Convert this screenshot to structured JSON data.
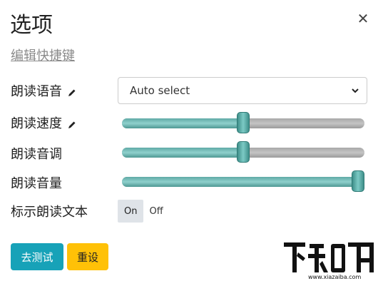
{
  "dialog": {
    "title": "选项",
    "shortcut_link": "编辑快捷键"
  },
  "settings": {
    "voice": {
      "label": "朗读语音",
      "selected": "Auto select"
    },
    "speed": {
      "label": "朗读速度",
      "value_fraction": 0.5
    },
    "pitch": {
      "label": "朗读音调",
      "value_fraction": 0.5
    },
    "volume": {
      "label": "朗读音量",
      "value_fraction": 1.0
    },
    "highlight": {
      "label": "标示朗读文本",
      "on_label": "On",
      "off_label": "Off",
      "state": "On"
    }
  },
  "buttons": {
    "test": "去测试",
    "reset": "重设"
  },
  "watermark": {
    "logo_text": "下载吧",
    "url": "www.xiazaiba.com"
  },
  "colors": {
    "accent": "#17a2b8",
    "warning": "#ffc107",
    "slider_fill": "#6fb9b4"
  },
  "icons": {
    "close": "close-icon",
    "edit": "pencil-icon",
    "dropdown": "chevron-down-icon"
  }
}
